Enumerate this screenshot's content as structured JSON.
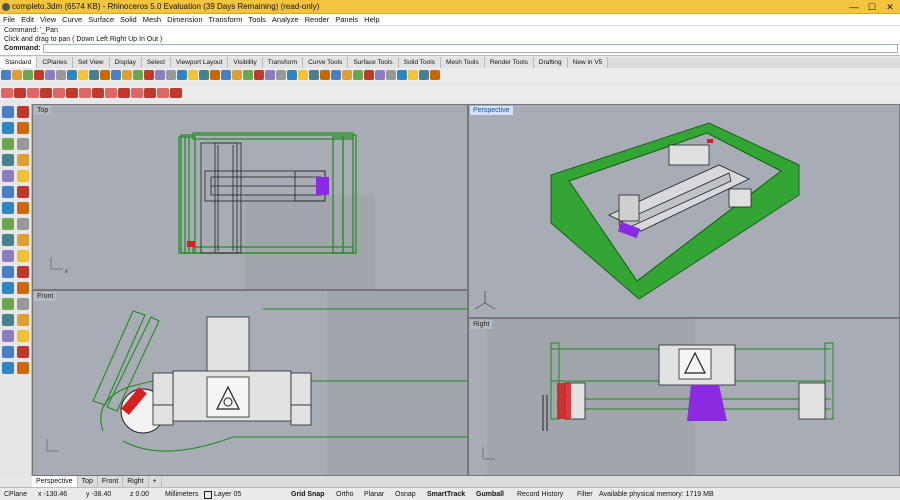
{
  "titlebar": {
    "title": "completo.3dm (6574 KB) - Rhinoceros 5.0 Evaluation (39 Days Remaining) (read-only)",
    "minimize": "—",
    "maximize": "☐",
    "close": "✕"
  },
  "menu": [
    "File",
    "Edit",
    "View",
    "Curve",
    "Surface",
    "Solid",
    "Mesh",
    "Dimension",
    "Transform",
    "Tools",
    "Analyze",
    "Render",
    "Panels",
    "Help"
  ],
  "command": {
    "history1": "Command: '_Pan",
    "history2": "Click and drag to pan ( Down  Left  Right  Up  In  Out )",
    "prompt": "Command:"
  },
  "toolbar_tabs": [
    "Standard",
    "CPlanes",
    "Set View",
    "Display",
    "Select",
    "Viewport Layout",
    "Visibility",
    "Transform",
    "Curve Tools",
    "Surface Tools",
    "Solid Tools",
    "Mesh Tools",
    "Render Tools",
    "Drafting",
    "New in V5"
  ],
  "viewports": {
    "top": {
      "label": "Top"
    },
    "perspective": {
      "label": "Perspective"
    },
    "front": {
      "label": "Front"
    },
    "right": {
      "label": "Right"
    }
  },
  "axis_labels": {
    "x": "x",
    "y": "y",
    "z": "z"
  },
  "viewport_tabs": [
    "Perspective",
    "Top",
    "Front",
    "Right"
  ],
  "viewport_tab_add": "+",
  "status": {
    "cplane": "CPlane",
    "x": "x -130.46",
    "y": "y -38.40",
    "z": "z 0.00",
    "units": "Millimeters",
    "layer": "Layer 05",
    "grid_snap": "Grid Snap",
    "ortho": "Ortho",
    "planar": "Planar",
    "osnap": "Osnap",
    "smarttrack": "SmartTrack",
    "gumball": "Gumball",
    "record_history": "Record History",
    "filter": "Filter",
    "memory": "Available physical memory: 1719 MB"
  },
  "colors": {
    "titlebar": "#f3c53f",
    "viewport_bg": "#a8adb5",
    "model_green": "#1e8c1e",
    "model_purple": "#8a2be2",
    "model_red": "#d62020"
  }
}
